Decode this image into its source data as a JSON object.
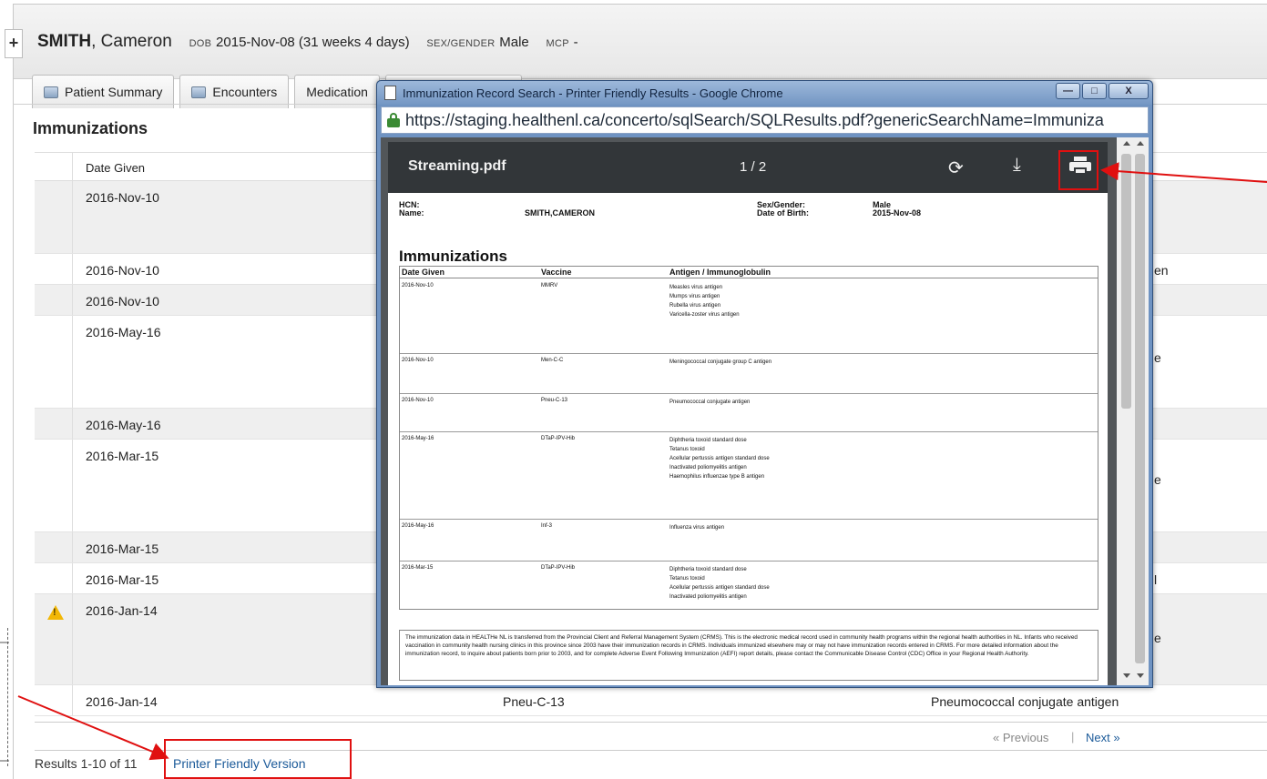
{
  "patient": {
    "expand_symbol": "+",
    "surname": "SMITH",
    "given": "Cameron",
    "dob_label": "DOB",
    "dob": "2015-Nov-08 (31 weeks 4 days)",
    "sex_label": "SEX/GENDER",
    "sex": "Male",
    "mcp_label": "MCP",
    "mcp": "-"
  },
  "tabs": [
    {
      "label": "Patient Summary",
      "icon": "summary-icon"
    },
    {
      "label": "Encounters",
      "icon": "encounters-icon"
    },
    {
      "label": "Medication",
      "icon": ""
    }
  ],
  "section_title": "Immunizations",
  "table": {
    "header_date": "Date Given",
    "rows": [
      {
        "date": "2016-Nov-10",
        "vaccine": "",
        "antigen": "",
        "warn": false
      },
      {
        "date": "2016-Nov-10",
        "vaccine": "",
        "antigen": "en",
        "warn": false
      },
      {
        "date": "2016-Nov-10",
        "vaccine": "",
        "antigen": "",
        "warn": false
      },
      {
        "date": "2016-May-16",
        "vaccine": "",
        "antigen": "e",
        "warn": false
      },
      {
        "date": "2016-May-16",
        "vaccine": "",
        "antigen": "",
        "warn": false
      },
      {
        "date": "2016-Mar-15",
        "vaccine": "",
        "antigen": "e",
        "warn": false
      },
      {
        "date": "2016-Mar-15",
        "vaccine": "",
        "antigen": "",
        "warn": false
      },
      {
        "date": "2016-Mar-15",
        "vaccine": "",
        "antigen": "l",
        "warn": false
      },
      {
        "date": "2016-Jan-14",
        "vaccine": "",
        "antigen": "e",
        "warn": true
      },
      {
        "date": "2016-Jan-14",
        "vaccine": "Pneu-C-13",
        "antigen": "Pneumococcal conjugate antigen",
        "warn": false
      }
    ]
  },
  "pager": {
    "prev": "« Previous",
    "sep": "|",
    "next": "Next »"
  },
  "results_text": "Results 1-10 of 11",
  "printer_friendly_link": "Printer Friendly Version",
  "annotation_color": "#e01010",
  "chrome": {
    "title": "Immunization Record Search - Printer Friendly Results - Google Chrome",
    "minimize": "—",
    "maximize": "□",
    "close": "X",
    "url": "https://staging.healthenl.ca/concerto/sqlSearch/SQLResults.pdf?genericSearchName=Immuniza"
  },
  "pdf": {
    "filename": "Streaming.pdf",
    "page_count": "1 / 2",
    "rotate_icon": "rotate-icon",
    "download_icon": "download-icon",
    "print_icon": "print-icon",
    "hcn_label": "HCN:",
    "name_label": "Name:",
    "name": "SMITH,CAMERON",
    "sex_label": "Sex/Gender:",
    "sex": "Male",
    "dob_label": "Date of Birth:",
    "dob": "2015-Nov-08",
    "title": "Immunizations",
    "col_date": "Date Given",
    "col_vaccine": "Vaccine",
    "col_antigen": "Antigen / Immunoglobulin",
    "records": [
      {
        "date": "2016-Nov-10",
        "vaccine": "MMRV",
        "antigens": [
          "Measles virus antigen",
          "Mumps virus antigen",
          "Rubella virus antigen",
          "Varicella-zoster virus antigen"
        ]
      },
      {
        "date": "2016-Nov-10",
        "vaccine": "Men-C-C",
        "antigens": [
          "Meningococcal conjugate group C antigen"
        ]
      },
      {
        "date": "2016-Nov-10",
        "vaccine": "Pneu-C-13",
        "antigens": [
          "Pneumococcal conjugate antigen"
        ]
      },
      {
        "date": "2016-May-16",
        "vaccine": "DTaP-IPV-Hib",
        "antigens": [
          "Diphtheria toxoid standard dose",
          "Tetanus toxoid",
          "Acellular pertussis antigen standard dose",
          "Inactivated poliomyelitis antigen",
          "Haemophilus influenzae type B antigen"
        ]
      },
      {
        "date": "2016-May-16",
        "vaccine": "Inf-3",
        "antigens": [
          "Influenza virus antigen"
        ]
      },
      {
        "date": "2016-Mar-15",
        "vaccine": "DTaP-IPV-Hib",
        "antigens": [
          "Diphtheria toxoid standard dose",
          "Tetanus toxoid",
          "Acellular pertussis antigen standard dose",
          "Inactivated poliomyelitis antigen"
        ]
      }
    ],
    "footnote": "The immunization data in HEALTHe NL is transferred from the Provincial Client and Referral Management System (CRMS). This is the electronic medical record used in community health programs within the regional health authorities in NL. Infants who received vaccination in community health nursing clinics in this province since 2003 have their immunization records in CRMS. Individuals immunized elsewhere may or may not have immunization records entered in CRMS. For more detailed information about the immunization record, to inquire about patients born prior to 2003, and for complete Adverse Event Following Immunization (AEFI) report details, please contact the Communicable Disease Control (CDC) Office in your Regional Health Authority."
  }
}
